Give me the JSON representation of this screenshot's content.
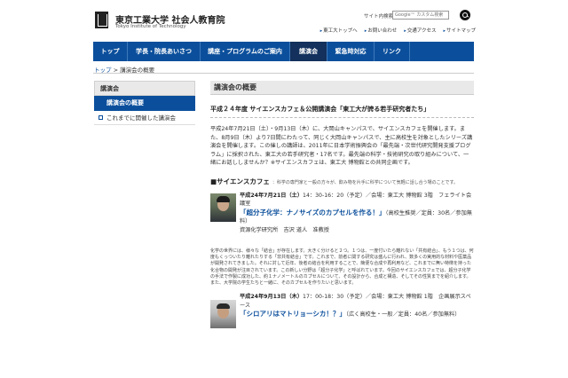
{
  "header": {
    "logo_jp": "東京工業大学 社会人教育院",
    "logo_en": "Tokyo Institute of Technology",
    "search_label": "サイト内検索",
    "search_placeholder": "Google™ カスタム検索",
    "toplinks": [
      "東工大トップへ",
      "お問い合わせ",
      "交通アクセス",
      "サイトマップ"
    ]
  },
  "nav": {
    "items": [
      "トップ",
      "学長・院長あいさつ",
      "講座・プログラムのご案内",
      "講演会",
      "緊急時対応",
      "リンク"
    ],
    "active": "講演会"
  },
  "breadcrumb": {
    "home": "トップ",
    "separator": ">",
    "current": "講演会の概要"
  },
  "sidebar": {
    "heading": "講演会",
    "active_item": "講演会の概要",
    "items": [
      "これまでに開催した講演会"
    ]
  },
  "main": {
    "title": "講演会の概要",
    "subtitle": "平成２４年度 サイエンスカフェ＆公開講演会「東工大が誇る若手研究者たち」",
    "intro": "平成24年7月21日（土）・9月13日（木）に、大岡山キャンパスで、サイエンスカフェを開催します。また、8月9日（木）より7日間にわたって、同じく大岡山キャンパスで、主に高校生を対象としたシリーズ講演会を開催します。この催しの講師は、2011年に日本学術振興会の「最先端・次世代研究開発支援プログラム」に採択された、東工大の若手研究者・17名です。最先端の科学・技術研究の取り組みについて、一緒にお話ししませんか？※サイエンスカフェは、東工大 博物館との共同企画です。",
    "section_head": "■サイエンスカフェ",
    "section_note": "：科学の専門家と一般の方々が、飲み物を片手に科学について気軽に話し合う場のことです。",
    "events": [
      {
        "date": "平成24年7月21日（土）",
        "details": "14：30-16：20（予定）／会場：東工大 博物館 3階　フェライト会議室",
        "lecture": "「超分子化学：ナノサイズのカプセルを作る！」",
        "audience": "（高校生推奨／定員：30名／参加無料）",
        "speaker": "資源化学研究所　吉沢 道人　准教授"
      },
      {
        "date": "平成24年9月13日（木）",
        "details": "17：00-18：30（予定）／会場：東工大 博物館 1階　企画展示スペース",
        "lecture": "「シロアリはマトリョーシカ！？」",
        "audience": "（広く高校生・一般／定員：40名／参加無料）",
        "speaker": ""
      }
    ],
    "long_text": "化学の世界には、様々な「結合」が存在します。大きく分けると２つ。１つは、一度付いたら離れない「共有結合」、もう１つは、何度もくっついたり離れたりする「非共有結合」です。これまで、前者に関する研究は盛んに行われ、数多くの実用的な材料や医薬品が開発されてきました。それに対して近年、後者の結合を利用することで、簡便な合成や再利用など、これまでに無い特徴を持った化合物の開発が注目されています。この新しい分野は「超分子化学」と呼ばれています。今回のサイエンスカフェでは、超分子化学の手法で作製に成功した、約１ナノメートルのカプセルについて、その設計から、合成と構造、そしてその性質までを紹介します。また、大学院の学生たちと一緒に、そのカプセルを作りたいと思います。"
  }
}
